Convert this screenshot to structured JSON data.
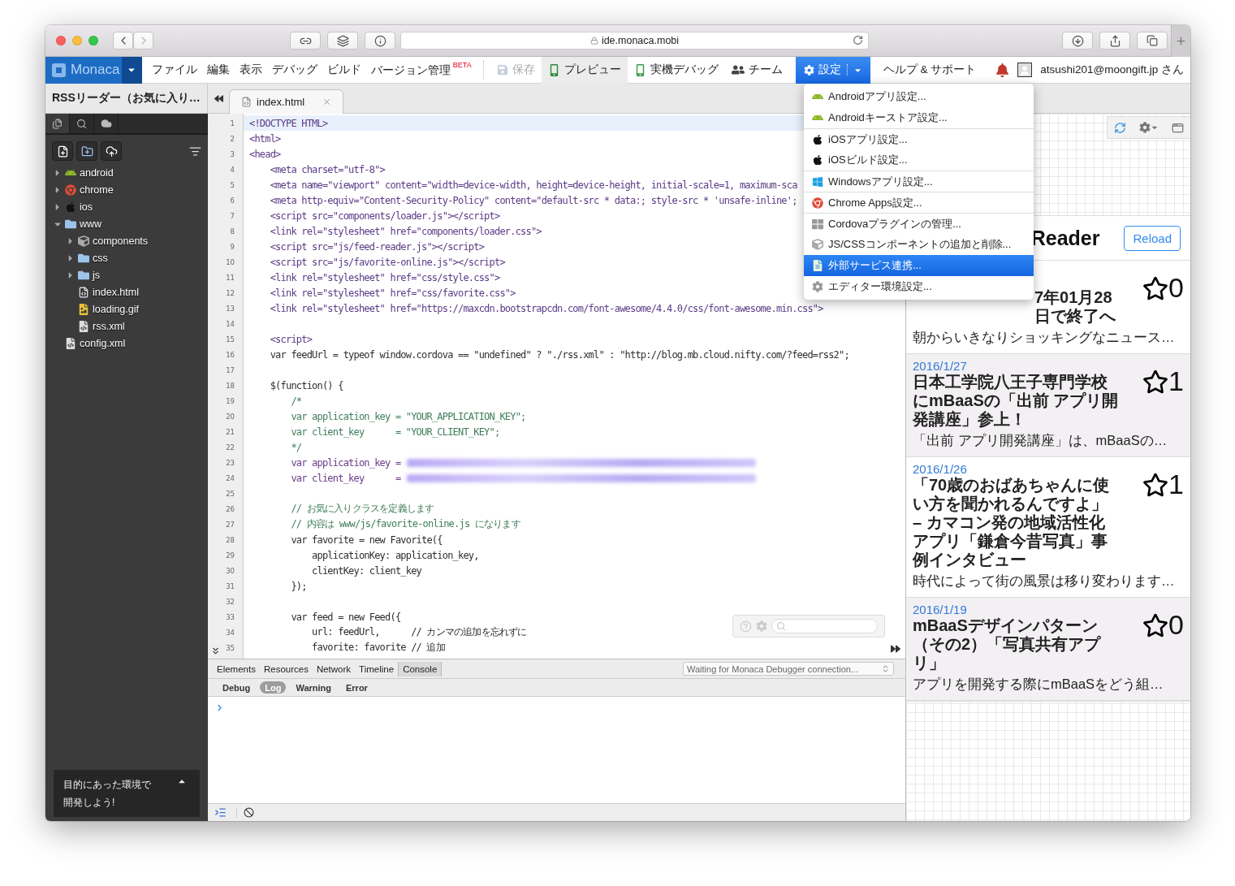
{
  "browser": {
    "url": "ide.monaca.mobi"
  },
  "menubar": {
    "logo": "Monaca",
    "menus": [
      {
        "label": "ファイル"
      },
      {
        "label": "編集"
      },
      {
        "label": "表示"
      },
      {
        "label": "デバッグ"
      },
      {
        "label": "ビルド"
      },
      {
        "label": "バージョン管理",
        "badge": "BETA"
      }
    ],
    "tools": [
      {
        "kind": "save",
        "label": "保存",
        "disabled": true,
        "pressed": false
      },
      {
        "kind": "preview",
        "label": "プレビュー",
        "disabled": false,
        "pressed": true
      },
      {
        "kind": "device",
        "label": "実機デバッグ",
        "disabled": false,
        "pressed": false
      },
      {
        "kind": "team",
        "label": "チーム",
        "disabled": false,
        "pressed": false
      },
      {
        "kind": "settings",
        "label": "設定",
        "disabled": false,
        "pressed": true
      }
    ],
    "help": "ヘルプ & サポート",
    "user": "atsushi201@moongift.jp さん"
  },
  "project": {
    "title": "RSSリーダー（お気に入り…"
  },
  "editor_tabs": [
    {
      "label": "index.html",
      "selected": true
    }
  ],
  "sidebar": {
    "tabs": [
      {
        "kind": "files",
        "selected": true
      },
      {
        "kind": "search",
        "selected": false
      },
      {
        "kind": "cloud",
        "selected": false
      }
    ],
    "tree": [
      {
        "label": "android",
        "kind": "android",
        "expanded": false
      },
      {
        "label": "chrome",
        "kind": "chrome",
        "expanded": false
      },
      {
        "label": "ios",
        "kind": "apple",
        "expanded": false
      },
      {
        "label": "www",
        "kind": "folder",
        "expanded": true,
        "children": [
          {
            "label": "components",
            "kind": "package",
            "expanded": false
          },
          {
            "label": "css",
            "kind": "folder",
            "expanded": false
          },
          {
            "label": "js",
            "kind": "folder",
            "expanded": false
          },
          {
            "label": "index.html",
            "kind": "html"
          },
          {
            "label": "loading.gif",
            "kind": "image"
          },
          {
            "label": "rss.xml",
            "kind": "xml"
          }
        ]
      },
      {
        "label": "config.xml",
        "kind": "xml"
      }
    ],
    "promo": [
      "目的にあった環境で",
      "開発しよう!"
    ]
  },
  "code": {
    "lines": [
      {
        "n": "1",
        "code": "<!DOCTYPE HTML>",
        "kind": "markup",
        "current": true
      },
      {
        "n": "2",
        "code": "<html>",
        "kind": "markup",
        "current": false
      },
      {
        "n": "3",
        "code": "<head>",
        "kind": "markup",
        "current": false
      },
      {
        "n": "4",
        "code": "    <meta charset=\"utf-8\">",
        "kind": "markup",
        "current": false
      },
      {
        "n": "5",
        "code": "    <meta name=\"viewport\" content=\"width=device-width, height=device-height, initial-scale=1, maximum-sca",
        "kind": "markup",
        "current": false
      },
      {
        "n": "6",
        "code": "    <meta http-equiv=\"Content-Security-Policy\" content=\"default-src * data:; style-src * 'unsafe-inline';",
        "kind": "markup",
        "current": false
      },
      {
        "n": "7",
        "code": "    <script src=\"components/loader.js\"></script>",
        "kind": "markup",
        "current": false
      },
      {
        "n": "8",
        "code": "    <link rel=\"stylesheet\" href=\"components/loader.css\">",
        "kind": "markup",
        "current": false
      },
      {
        "n": "9",
        "code": "    <script src=\"js/feed-reader.js\"></script>",
        "kind": "markup",
        "current": false
      },
      {
        "n": "10",
        "code": "    <script src=\"js/favorite-online.js\"></script>",
        "kind": "markup",
        "current": false
      },
      {
        "n": "11",
        "code": "    <link rel=\"stylesheet\" href=\"css/style.css\">",
        "kind": "markup",
        "current": false
      },
      {
        "n": "12",
        "code": "    <link rel=\"stylesheet\" href=\"css/favorite.css\">",
        "kind": "markup",
        "current": false
      },
      {
        "n": "13",
        "code": "    <link rel=\"stylesheet\" href=\"https://maxcdn.bootstrapcdn.com/font-awesome/4.4.0/css/font-awesome.min.css\">",
        "kind": "markup",
        "current": false
      },
      {
        "n": "14",
        "kind": "js",
        "current": false
      },
      {
        "n": "15",
        "code": "    <script>",
        "kind": "markup",
        "current": false
      },
      {
        "n": "16",
        "code": "    var feedUrl = typeof window.cordova == \"undefined\" ? \"./rss.xml\" : \"http://blog.mb.cloud.nifty.com/?feed=rss2\";",
        "kind": "js",
        "current": false
      },
      {
        "n": "17",
        "kind": "js",
        "current": false
      },
      {
        "n": "18",
        "code": "    $(function() {",
        "kind": "js",
        "current": false
      },
      {
        "n": "19",
        "code": "        /*",
        "kind": "comment",
        "current": false
      },
      {
        "n": "20",
        "code": "        var application_key = \"YOUR_APPLICATION_KEY\";",
        "kind": "comment",
        "current": false
      },
      {
        "n": "21",
        "code": "        var client_key      = \"YOUR_CLIENT_KEY\";",
        "kind": "comment",
        "current": false
      },
      {
        "n": "22",
        "code": "        */",
        "kind": "comment",
        "current": false
      },
      {
        "n": "23",
        "code": "        var application_key =",
        "kind": "redacted",
        "current": false
      },
      {
        "n": "24",
        "code": "        var client_key      =",
        "kind": "redacted",
        "current": false
      },
      {
        "n": "25",
        "kind": "js",
        "current": false
      },
      {
        "n": "26",
        "code": "        // お気に入りクラスを定義します",
        "kind": "comment",
        "current": false
      },
      {
        "n": "27",
        "code": "        // 内容は www/js/favorite-online.js になります",
        "kind": "comment",
        "current": false
      },
      {
        "n": "28",
        "code": "        var favorite = new Favorite({",
        "kind": "js",
        "current": false
      },
      {
        "n": "29",
        "code": "            applicationKey: application_key,",
        "kind": "js",
        "current": false
      },
      {
        "n": "30",
        "code": "            clientKey: client_key",
        "kind": "js",
        "current": false
      },
      {
        "n": "31",
        "code": "        });",
        "kind": "js",
        "current": false
      },
      {
        "n": "32",
        "kind": "js",
        "current": false
      },
      {
        "n": "33",
        "code": "        var feed = new Feed({",
        "kind": "js",
        "current": false
      },
      {
        "n": "34",
        "code": "            url: feedUrl,      // カンマの追加を忘れずに",
        "kind": "js",
        "current": false
      },
      {
        "n": "35",
        "code": "            favorite: favorite // 追加",
        "kind": "js",
        "current": false
      }
    ]
  },
  "devtools": {
    "tabs": [
      {
        "label": "Elements",
        "selected": false
      },
      {
        "label": "Resources",
        "selected": false
      },
      {
        "label": "Network",
        "selected": false
      },
      {
        "label": "Timeline",
        "selected": false
      },
      {
        "label": "Console",
        "selected": true
      }
    ],
    "status": "Waiting for Monaca Debugger connection...",
    "filters": [
      {
        "label": "Debug",
        "selected": false
      },
      {
        "label": "Log",
        "selected": true
      },
      {
        "label": "Warning",
        "selected": false
      },
      {
        "label": "Error",
        "selected": false
      }
    ]
  },
  "settings_menu": {
    "items": [
      {
        "kind": "android",
        "label": "Androidアプリ設定...",
        "separated": false,
        "selected": false
      },
      {
        "kind": "android",
        "label": "Androidキーストア設定...",
        "separated": false,
        "selected": false
      },
      {
        "kind": "apple",
        "label": "iOSアプリ設定...",
        "separated": true,
        "selected": false
      },
      {
        "kind": "apple",
        "label": "iOSビルド設定...",
        "separated": false,
        "selected": false
      },
      {
        "kind": "windows",
        "label": "Windowsアプリ設定...",
        "separated": true,
        "selected": false
      },
      {
        "kind": "chrome",
        "label": "Chrome Apps設定...",
        "separated": true,
        "selected": false
      },
      {
        "kind": "grid",
        "label": "Cordovaプラグインの管理...",
        "separated": true,
        "selected": false
      },
      {
        "kind": "package",
        "label": "JS/CSSコンポーネントの追加と削除...",
        "separated": false,
        "selected": false
      },
      {
        "kind": "file",
        "label": "外部サービス連携...",
        "separated": false,
        "selected": true
      },
      {
        "kind": "gear",
        "label": "エディター環境設定...",
        "separated": false,
        "selected": false
      }
    ]
  },
  "preview": {
    "title": "Reader",
    "reload": "Reload",
    "articles": [
      {
        "title": "7年01月28日で終了へ",
        "snippet": "朝からいきなりショッキングなニュース…",
        "count": "0",
        "kind": "partial"
      },
      {
        "date": "2016/1/27",
        "title": "日本工学院八王子専門学校にmBaaSの「出前 アプリ開発講座」参上！",
        "snippet": "「出前 アプリ開発講座」は、mBaaSの…",
        "count": "1",
        "kind": "full"
      },
      {
        "date": "2016/1/26",
        "title": "「70歳のおばあちゃんに使い方を聞かれるんですよ」 – カマコン発の地域活性化アプリ「鎌倉今昔写真」事例インタビュー",
        "snippet": "時代によって街の風景は移り変わります…",
        "count": "1",
        "kind": "full"
      },
      {
        "date": "2016/1/19",
        "title": "mBaaSデザインパターン（その2）「写真共有アプリ」",
        "snippet": "アプリを開発する際にmBaaSをどう組…",
        "count": "0",
        "kind": "full"
      }
    ]
  }
}
